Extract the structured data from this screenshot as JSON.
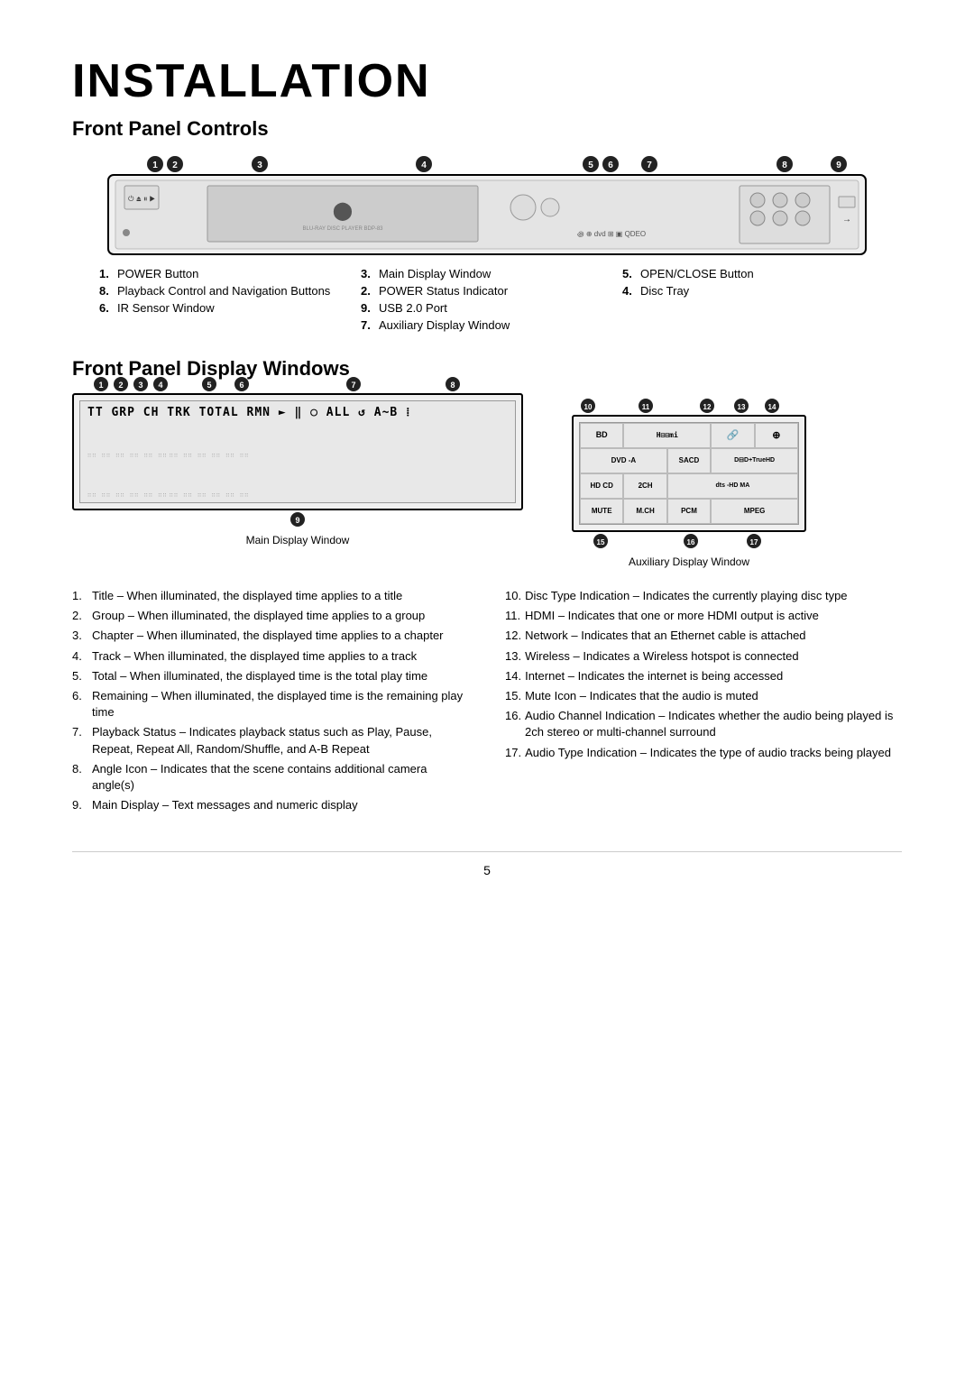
{
  "page": {
    "title": "INSTALLATION",
    "section1": "Front Panel Controls",
    "section2": "Front Panel Display Windows",
    "page_number": "5"
  },
  "front_panel_controls": {
    "items": [
      {
        "num": "1.",
        "label": "POWER Button"
      },
      {
        "num": "3.",
        "label": "Main Display Window"
      },
      {
        "num": "5.",
        "label": "OPEN/CLOSE Button"
      },
      {
        "num": "8.",
        "label": "Playback Control and Navigation Buttons"
      },
      {
        "num": "2.",
        "label": "POWER Status Indicator"
      },
      {
        "num": "4.",
        "label": "Disc Tray"
      },
      {
        "num": "6.",
        "label": "IR Sensor Window"
      },
      {
        "num": "9.",
        "label": "USB 2.0 Port"
      },
      {
        "num": "",
        "label": ""
      },
      {
        "num": "",
        "label": ""
      },
      {
        "num": "7.",
        "label": "Auxiliary Display Window"
      },
      {
        "num": "",
        "label": ""
      }
    ]
  },
  "main_display_window_label": "Main Display Window",
  "aux_display_window_label": "Auxiliary Display Window",
  "display_top_text": "TT GRP CH TRK TOTAL RMN ▶ ‖ ○ ALL ⟲ A~B ⠿",
  "aux_grid": [
    {
      "label": "BD",
      "span": 1
    },
    {
      "label": "HDMI",
      "span": 2
    },
    {
      "label": "🔗",
      "span": 1
    },
    {
      "label": "⊕",
      "span": 1
    },
    {
      "label": "DVD -A",
      "span": 2
    },
    {
      "label": "SACD",
      "span": 1
    },
    {
      "label": "DD+TrueHD",
      "span": 2
    },
    {
      "label": "HD CD",
      "span": 1
    },
    {
      "label": "2CH",
      "span": 1
    },
    {
      "label": "dts -HD MA",
      "span": 3
    },
    {
      "label": "MUTE",
      "span": 1
    },
    {
      "label": "M.CH",
      "span": 1
    },
    {
      "label": "PCM",
      "span": 1
    },
    {
      "label": "MPEG",
      "span": 2
    }
  ],
  "display_items_left": [
    {
      "num": "1.",
      "text": "Title – When illuminated, the displayed time applies to a title"
    },
    {
      "num": "2.",
      "text": "Group – When illuminated, the displayed time applies to a group"
    },
    {
      "num": "3.",
      "text": "Chapter – When illuminated, the displayed time applies to a chapter"
    },
    {
      "num": "4.",
      "text": "Track – When illuminated, the displayed time applies to a track"
    },
    {
      "num": "5.",
      "text": "Total – When illuminated, the displayed time is the total play time"
    },
    {
      "num": "6.",
      "text": "Remaining – When illuminated, the displayed time is the remaining play time"
    },
    {
      "num": "7.",
      "text": "Playback Status – Indicates playback status such as Play, Pause, Repeat, Repeat All, Random/Shuffle, and A-B Repeat"
    },
    {
      "num": "8.",
      "text": "Angle Icon – Indicates that the scene contains additional camera angle(s)"
    },
    {
      "num": "9.",
      "text": "Main Display – Text messages and numeric display"
    }
  ],
  "display_items_right": [
    {
      "num": "10.",
      "text": "Disc Type Indication – Indicates the currently playing disc type"
    },
    {
      "num": "11.",
      "text": "HDMI – Indicates that one or more HDMI output is active"
    },
    {
      "num": "12.",
      "text": "Network – Indicates that an Ethernet cable is attached"
    },
    {
      "num": "13.",
      "text": "Wireless – Indicates a Wireless hotspot is connected"
    },
    {
      "num": "14.",
      "text": "Internet – Indicates the internet is being accessed"
    },
    {
      "num": "15.",
      "text": "Mute Icon – Indicates that the audio is muted"
    },
    {
      "num": "16.",
      "text": "Audio Channel Indication – Indicates whether the audio being played is 2ch stereo or multi-channel surround"
    },
    {
      "num": "17.",
      "text": "Audio Type Indication – Indicates the type of audio tracks being played"
    }
  ]
}
